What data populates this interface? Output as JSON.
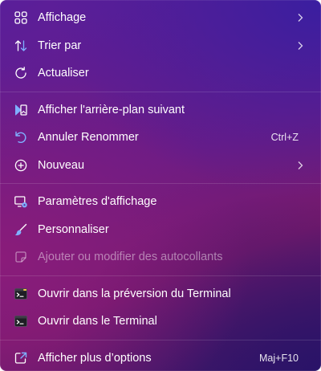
{
  "menu": {
    "items": [
      {
        "label": "Affichage",
        "icon": "view-grid-icon",
        "submenu": true
      },
      {
        "label": "Trier par",
        "icon": "sort-arrows-icon",
        "submenu": true
      },
      {
        "label": "Actualiser",
        "icon": "refresh-icon"
      },
      {
        "label": "Afficher l'arrière-plan suivant",
        "icon": "next-background-icon"
      },
      {
        "label": "Annuler Renommer",
        "icon": "undo-icon",
        "shortcut": "Ctrl+Z"
      },
      {
        "label": "Nouveau",
        "icon": "new-plus-circle-icon",
        "submenu": true
      },
      {
        "label": "Paramètres d'affichage",
        "icon": "display-settings-icon"
      },
      {
        "label": "Personnaliser",
        "icon": "paint-brush-icon"
      },
      {
        "label": "Ajouter ou modifier des autocollants",
        "icon": "sticker-icon",
        "disabled": true
      },
      {
        "label": "Ouvrir dans la préversion du Terminal",
        "icon": "terminal-preview-icon"
      },
      {
        "label": "Ouvrir dans le Terminal",
        "icon": "terminal-icon"
      },
      {
        "label": "Afficher plus d’options",
        "icon": "more-options-icon",
        "shortcut": "Maj+F10"
      }
    ]
  },
  "colors": {
    "accent_icon": "#7fb0ff",
    "text": "#ffffff",
    "disabled_text": "rgba(255,255,255,0.45)"
  }
}
